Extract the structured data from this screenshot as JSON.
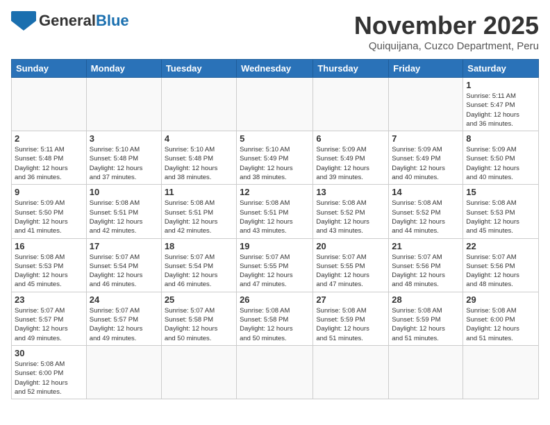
{
  "header": {
    "logo_general": "General",
    "logo_blue": "Blue",
    "month_title": "November 2025",
    "location": "Quiquijana, Cuzco Department, Peru"
  },
  "weekdays": [
    "Sunday",
    "Monday",
    "Tuesday",
    "Wednesday",
    "Thursday",
    "Friday",
    "Saturday"
  ],
  "weeks": [
    [
      {
        "day": "",
        "info": ""
      },
      {
        "day": "",
        "info": ""
      },
      {
        "day": "",
        "info": ""
      },
      {
        "day": "",
        "info": ""
      },
      {
        "day": "",
        "info": ""
      },
      {
        "day": "",
        "info": ""
      },
      {
        "day": "1",
        "info": "Sunrise: 5:11 AM\nSunset: 5:47 PM\nDaylight: 12 hours\nand 36 minutes."
      }
    ],
    [
      {
        "day": "2",
        "info": "Sunrise: 5:11 AM\nSunset: 5:48 PM\nDaylight: 12 hours\nand 36 minutes."
      },
      {
        "day": "3",
        "info": "Sunrise: 5:10 AM\nSunset: 5:48 PM\nDaylight: 12 hours\nand 37 minutes."
      },
      {
        "day": "4",
        "info": "Sunrise: 5:10 AM\nSunset: 5:48 PM\nDaylight: 12 hours\nand 38 minutes."
      },
      {
        "day": "5",
        "info": "Sunrise: 5:10 AM\nSunset: 5:49 PM\nDaylight: 12 hours\nand 38 minutes."
      },
      {
        "day": "6",
        "info": "Sunrise: 5:09 AM\nSunset: 5:49 PM\nDaylight: 12 hours\nand 39 minutes."
      },
      {
        "day": "7",
        "info": "Sunrise: 5:09 AM\nSunset: 5:49 PM\nDaylight: 12 hours\nand 40 minutes."
      },
      {
        "day": "8",
        "info": "Sunrise: 5:09 AM\nSunset: 5:50 PM\nDaylight: 12 hours\nand 40 minutes."
      }
    ],
    [
      {
        "day": "9",
        "info": "Sunrise: 5:09 AM\nSunset: 5:50 PM\nDaylight: 12 hours\nand 41 minutes."
      },
      {
        "day": "10",
        "info": "Sunrise: 5:08 AM\nSunset: 5:51 PM\nDaylight: 12 hours\nand 42 minutes."
      },
      {
        "day": "11",
        "info": "Sunrise: 5:08 AM\nSunset: 5:51 PM\nDaylight: 12 hours\nand 42 minutes."
      },
      {
        "day": "12",
        "info": "Sunrise: 5:08 AM\nSunset: 5:51 PM\nDaylight: 12 hours\nand 43 minutes."
      },
      {
        "day": "13",
        "info": "Sunrise: 5:08 AM\nSunset: 5:52 PM\nDaylight: 12 hours\nand 43 minutes."
      },
      {
        "day": "14",
        "info": "Sunrise: 5:08 AM\nSunset: 5:52 PM\nDaylight: 12 hours\nand 44 minutes."
      },
      {
        "day": "15",
        "info": "Sunrise: 5:08 AM\nSunset: 5:53 PM\nDaylight: 12 hours\nand 45 minutes."
      }
    ],
    [
      {
        "day": "16",
        "info": "Sunrise: 5:08 AM\nSunset: 5:53 PM\nDaylight: 12 hours\nand 45 minutes."
      },
      {
        "day": "17",
        "info": "Sunrise: 5:07 AM\nSunset: 5:54 PM\nDaylight: 12 hours\nand 46 minutes."
      },
      {
        "day": "18",
        "info": "Sunrise: 5:07 AM\nSunset: 5:54 PM\nDaylight: 12 hours\nand 46 minutes."
      },
      {
        "day": "19",
        "info": "Sunrise: 5:07 AM\nSunset: 5:55 PM\nDaylight: 12 hours\nand 47 minutes."
      },
      {
        "day": "20",
        "info": "Sunrise: 5:07 AM\nSunset: 5:55 PM\nDaylight: 12 hours\nand 47 minutes."
      },
      {
        "day": "21",
        "info": "Sunrise: 5:07 AM\nSunset: 5:56 PM\nDaylight: 12 hours\nand 48 minutes."
      },
      {
        "day": "22",
        "info": "Sunrise: 5:07 AM\nSunset: 5:56 PM\nDaylight: 12 hours\nand 48 minutes."
      }
    ],
    [
      {
        "day": "23",
        "info": "Sunrise: 5:07 AM\nSunset: 5:57 PM\nDaylight: 12 hours\nand 49 minutes."
      },
      {
        "day": "24",
        "info": "Sunrise: 5:07 AM\nSunset: 5:57 PM\nDaylight: 12 hours\nand 49 minutes."
      },
      {
        "day": "25",
        "info": "Sunrise: 5:07 AM\nSunset: 5:58 PM\nDaylight: 12 hours\nand 50 minutes."
      },
      {
        "day": "26",
        "info": "Sunrise: 5:08 AM\nSunset: 5:58 PM\nDaylight: 12 hours\nand 50 minutes."
      },
      {
        "day": "27",
        "info": "Sunrise: 5:08 AM\nSunset: 5:59 PM\nDaylight: 12 hours\nand 51 minutes."
      },
      {
        "day": "28",
        "info": "Sunrise: 5:08 AM\nSunset: 5:59 PM\nDaylight: 12 hours\nand 51 minutes."
      },
      {
        "day": "29",
        "info": "Sunrise: 5:08 AM\nSunset: 6:00 PM\nDaylight: 12 hours\nand 51 minutes."
      }
    ],
    [
      {
        "day": "30",
        "info": "Sunrise: 5:08 AM\nSunset: 6:00 PM\nDaylight: 12 hours\nand 52 minutes."
      },
      {
        "day": "",
        "info": ""
      },
      {
        "day": "",
        "info": ""
      },
      {
        "day": "",
        "info": ""
      },
      {
        "day": "",
        "info": ""
      },
      {
        "day": "",
        "info": ""
      },
      {
        "day": "",
        "info": ""
      }
    ]
  ]
}
